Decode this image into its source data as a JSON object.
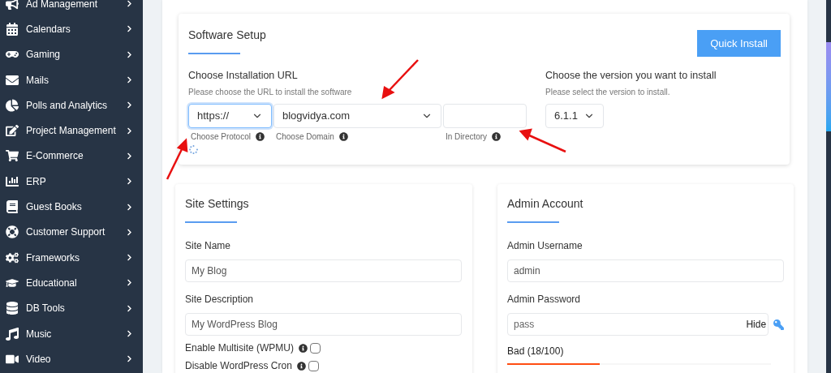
{
  "sidebar": {
    "items": [
      {
        "label": "Ad Management"
      },
      {
        "label": "Calendars"
      },
      {
        "label": "Gaming"
      },
      {
        "label": "Mails"
      },
      {
        "label": "Polls and Analytics"
      },
      {
        "label": "Project Management"
      },
      {
        "label": "E-Commerce"
      },
      {
        "label": "ERP"
      },
      {
        "label": "Guest Books"
      },
      {
        "label": "Customer Support"
      },
      {
        "label": "Frameworks"
      },
      {
        "label": "Educational"
      },
      {
        "label": "DB Tools"
      },
      {
        "label": "Music"
      },
      {
        "label": "Video"
      }
    ]
  },
  "software_setup": {
    "title": "Software Setup",
    "quick_install": "Quick Install",
    "url": {
      "heading": "Choose Installation URL",
      "hint": "Please choose the URL to install the software",
      "protocol": {
        "value": "https://",
        "label": "Choose Protocol",
        "focused": true
      },
      "domain": {
        "value": "blogvidya.com",
        "label": "Choose Domain",
        "focused": false
      },
      "directory": {
        "label": "In Directory",
        "focused": false
      }
    },
    "version": {
      "heading": "Choose the version you want to install",
      "hint": "Please select the version to install.",
      "value": "6.1.1",
      "focused": false
    }
  },
  "site_settings": {
    "title": "Site Settings",
    "fields": [
      {
        "label": "Site Name",
        "value": "My Blog"
      },
      {
        "label": "Site Description",
        "value": "My WordPress Blog"
      }
    ],
    "options": [
      {
        "label": "Enable Multisite (WPMU)",
        "checked": false
      },
      {
        "label": "Disable WordPress Cron",
        "checked": false
      }
    ]
  },
  "admin_account": {
    "title": "Admin Account",
    "username": {
      "label": "Admin Username",
      "value": "admin"
    },
    "password": {
      "label": "Admin Password",
      "value": "pass",
      "toggle": "Hide"
    },
    "strength": {
      "text": "Bad (18/100)",
      "level": 0.35
    }
  }
}
